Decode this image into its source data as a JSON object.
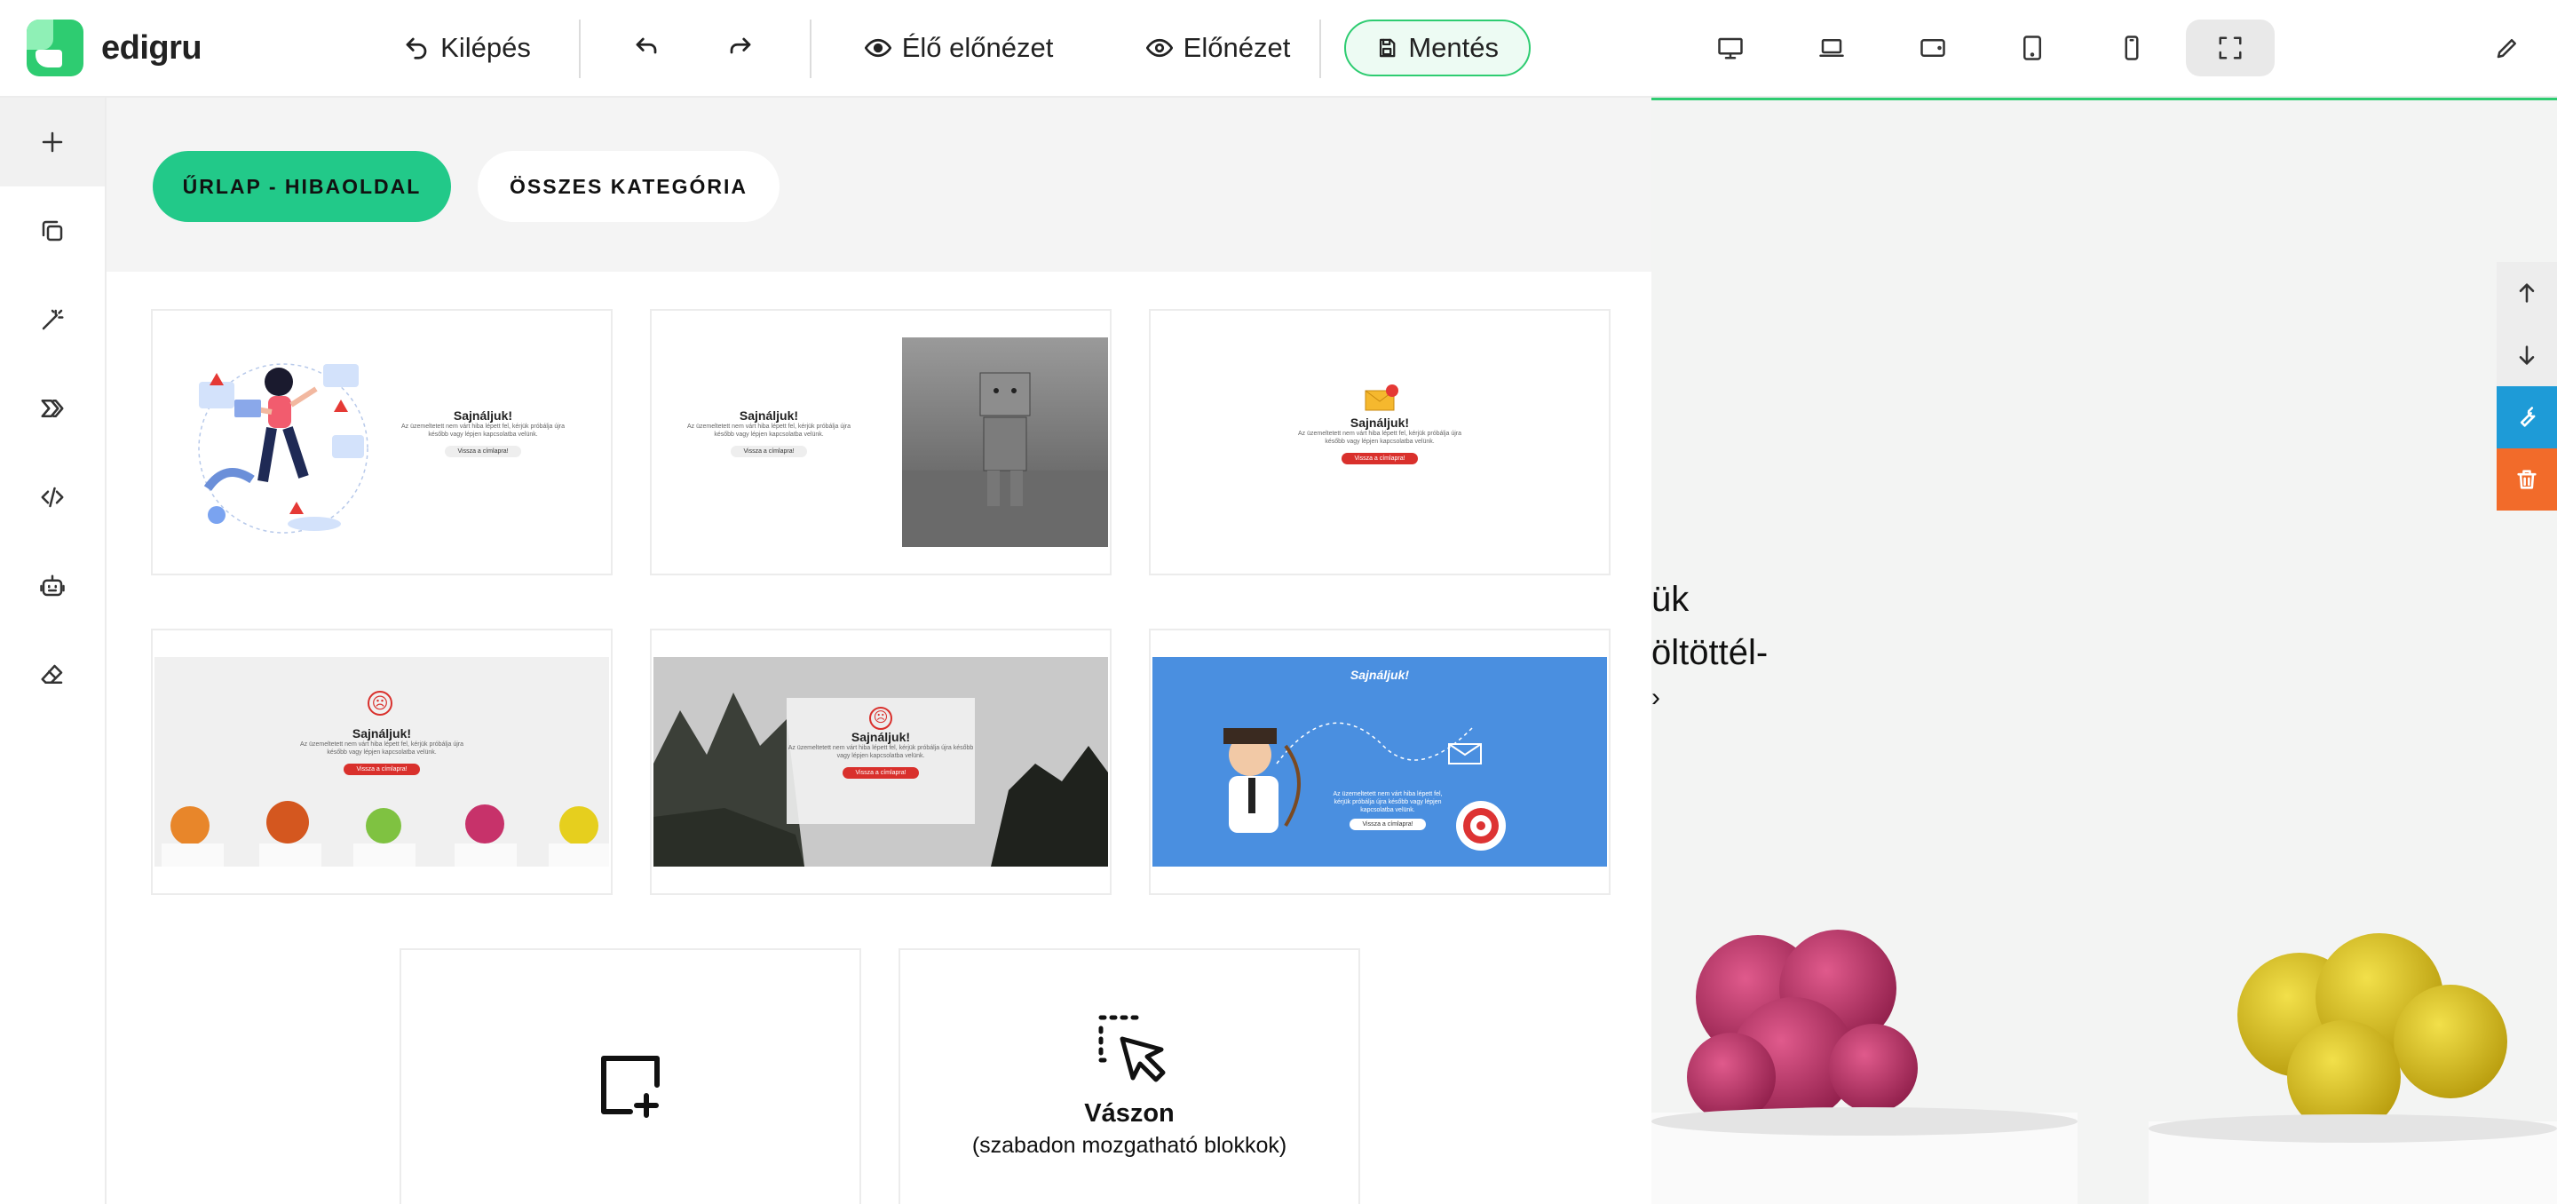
{
  "app": {
    "logo_text": "edigru"
  },
  "toolbar": {
    "exit_label": "Kilépés",
    "live_preview_label": "Élő előnézet",
    "preview_label": "Előnézet",
    "save_label": "Mentés"
  },
  "panel": {
    "category_active": "ŰRLAP - HIBAOLDAL",
    "category_all": "ÖSSZES KATEGÓRIA",
    "templates": [
      {
        "title": "Sajnáljuk!",
        "button": "Vissza a címlapra!"
      },
      {
        "title": "Sajnáljuk!",
        "button": "Vissza a címlapra!"
      },
      {
        "title": "Sajnáljuk!",
        "button": "Vissza a címlapra!"
      },
      {
        "title": "Sajnáljuk!",
        "button": "Vissza a címlapra!"
      },
      {
        "title": "Sajnáljuk!",
        "button": "Vissza a címlapra!"
      },
      {
        "title": "Sajnáljuk!",
        "button": "Vissza a címlapra!"
      }
    ],
    "template_body": "Az üzemeltetett nem várt hiba lépett fel, kérjük próbálja újra később vagy lépjen kapcsolatba velünk.",
    "canvas_title": "Vászon",
    "canvas_subtitle": "(szabadon mozgatható blokkok)"
  },
  "preview": {
    "text_line1": "ük",
    "text_line2": "öltöttél-",
    "text_line3": "›"
  },
  "colors": {
    "accent": "#2ecc71",
    "chip_active": "#22c989",
    "tool_blue": "#1e9bd7",
    "tool_orange": "#f26b2a",
    "error_red": "#d9302c",
    "template_blue": "#4a8fe0"
  }
}
